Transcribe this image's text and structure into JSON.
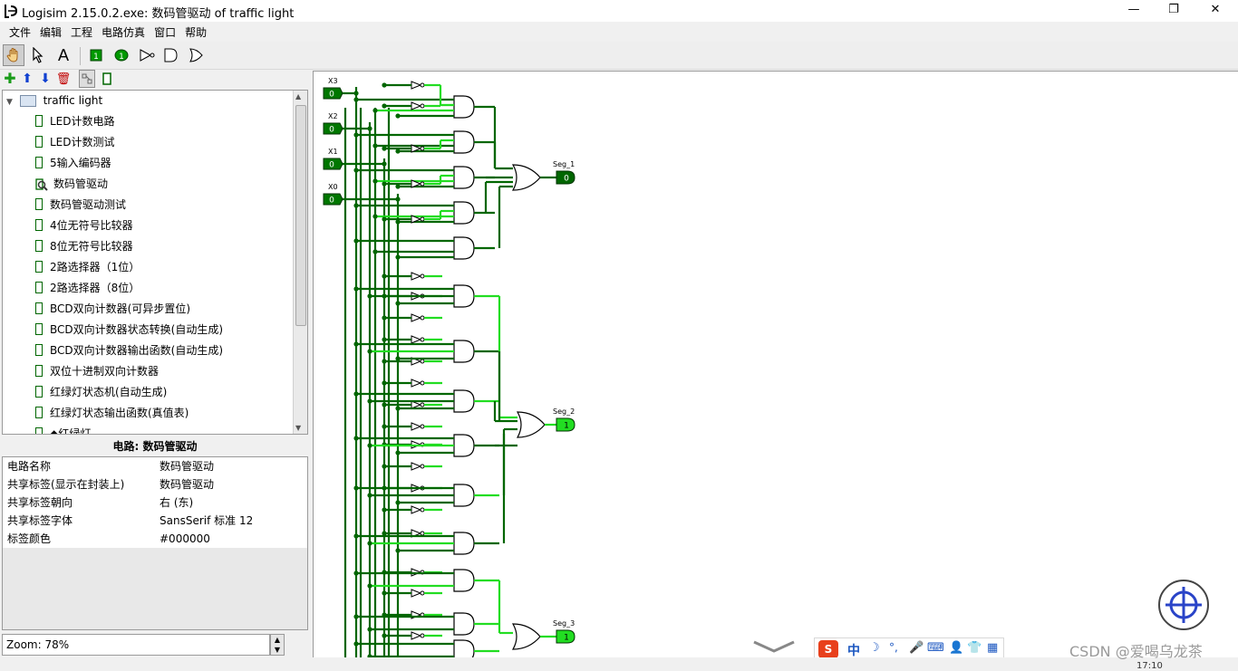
{
  "window": {
    "title": "Logisim 2.15.0.2.exe: 数码管驱动 of traffic light",
    "min": "—",
    "max": "❐",
    "close": "✕"
  },
  "menu": [
    "文件",
    "编辑",
    "工程",
    "电路仿真",
    "窗口",
    "帮助"
  ],
  "toolbar": {
    "tools": [
      "poke-tool",
      "select-tool",
      "text-tool",
      "input-pin",
      "output-pin",
      "not-gate",
      "and-gate",
      "or-gate"
    ],
    "text_tool_label": "A",
    "subtools": [
      "add-circuit",
      "move-up",
      "move-down",
      "delete-circuit",
      "layout-view",
      "appearance-view"
    ]
  },
  "tree": {
    "project": "traffic light",
    "items": [
      "LED计数电路",
      "LED计数测试",
      "5输入编码器",
      "数码管驱动",
      "数码管驱动测试",
      "4位无符号比较器",
      "8位无符号比较器",
      "2路选择器（1位）",
      "2路选择器（8位）",
      "BCD双向计数器(可异步置位)",
      "BCD双向计数器状态转换(自动生成)",
      "BCD双向计数器输出函数(自动生成)",
      "双位十进制双向计数器",
      "红绿灯状态机(自动生成)",
      "红绿灯状态输出函数(真值表)",
      "◆红绿灯"
    ],
    "active_index": 3
  },
  "properties": {
    "header": "电路: 数码管驱动",
    "rows": [
      {
        "key": "电路名称",
        "value": "数码管驱动"
      },
      {
        "key": "共享标签(显示在封装上)",
        "value": "数码管驱动"
      },
      {
        "key": "共享标签朝向",
        "value": "右 (东)"
      },
      {
        "key": "共享标签字体",
        "value": "SansSerif 标准 12"
      },
      {
        "key": "标签颜色",
        "value": "#000000"
      }
    ]
  },
  "zoom": "Zoom: 78%",
  "circuit": {
    "inputs": [
      {
        "label": "X3",
        "value": "0"
      },
      {
        "label": "X2",
        "value": "0"
      },
      {
        "label": "X1",
        "value": "0"
      },
      {
        "label": "X0",
        "value": "0"
      }
    ],
    "outputs": [
      {
        "label": "Seg_1",
        "value": "0"
      },
      {
        "label": "Seg_2",
        "value": "1"
      },
      {
        "label": "Seg_3",
        "value": "1"
      }
    ],
    "colors": {
      "wire_low": "#006600",
      "wire_high": "#22dd22",
      "pin_low": "#007700"
    }
  },
  "ime": {
    "brand": "S",
    "lang": "中"
  },
  "watermark": "CSDN @爱喝乌龙茶",
  "clock": "17:10"
}
